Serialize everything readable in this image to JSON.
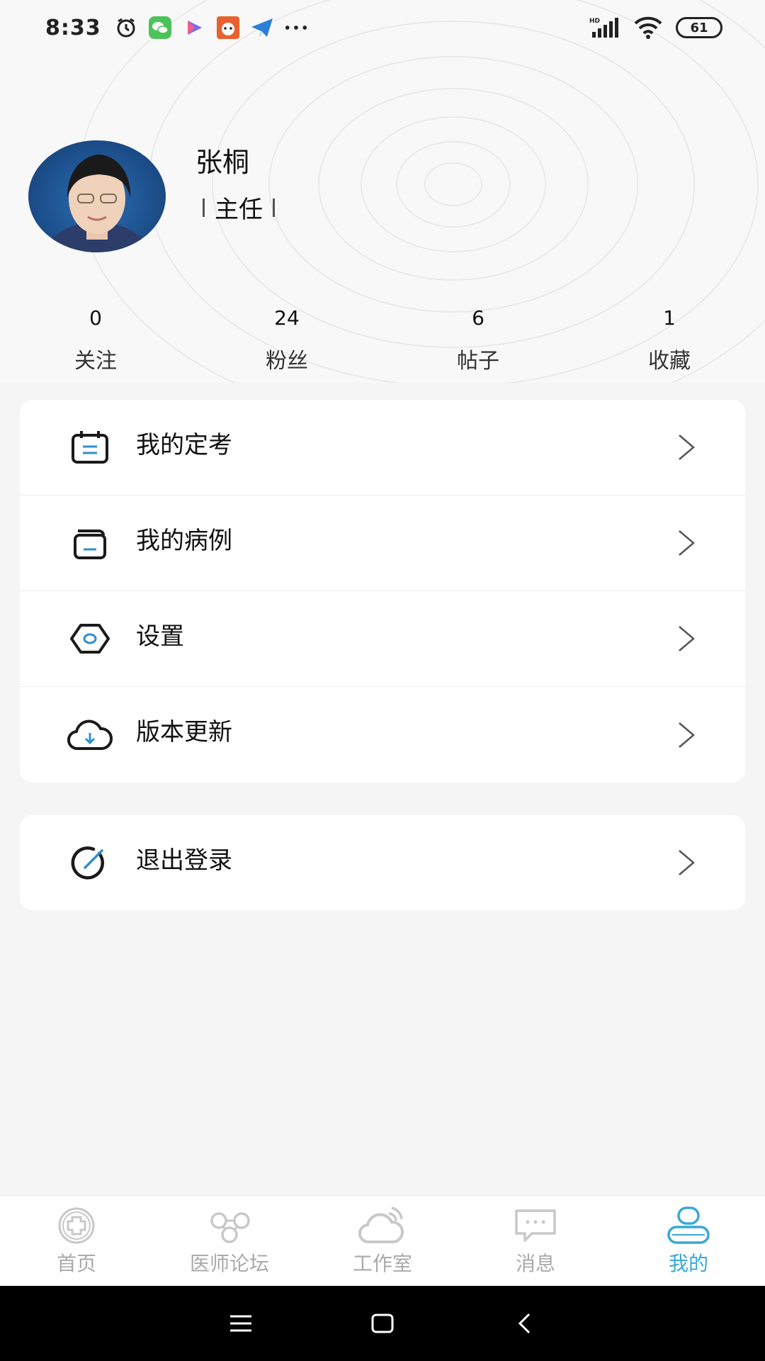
{
  "status_bar": {
    "time": "8:33",
    "battery": "61",
    "icons_left": [
      "alarm-icon",
      "wechat-icon",
      "video-icon",
      "app-icon",
      "send-icon",
      "more-icon"
    ],
    "icons_right": [
      "signal-hd-icon",
      "wifi-icon",
      "battery-icon"
    ]
  },
  "profile": {
    "name": "张桐",
    "title": "主任"
  },
  "stats": [
    {
      "value": "0",
      "label": "关注"
    },
    {
      "value": "24",
      "label": "粉丝"
    },
    {
      "value": "6",
      "label": "帖子"
    },
    {
      "value": "1",
      "label": "收藏"
    }
  ],
  "menu": [
    {
      "label": "我的定考",
      "icon": "calendar-icon"
    },
    {
      "label": "我的病例",
      "icon": "case-folder-icon"
    },
    {
      "label": "设置",
      "icon": "settings-hex-icon"
    },
    {
      "label": "版本更新",
      "icon": "cloud-download-icon"
    }
  ],
  "logout": {
    "label": "退出登录",
    "icon": "logout-icon"
  },
  "tabs": [
    {
      "label": "首页",
      "icon": "home-cross-icon"
    },
    {
      "label": "医师论坛",
      "icon": "forum-icon"
    },
    {
      "label": "工作室",
      "icon": "cloud-studio-icon"
    },
    {
      "label": "消息",
      "icon": "message-icon"
    },
    {
      "label": "我的",
      "icon": "profile-icon",
      "active": true
    }
  ],
  "colors": {
    "accent": "#39a8d6",
    "inactive": "#aaaaaa",
    "icon_accent": "#2f8fd0"
  }
}
